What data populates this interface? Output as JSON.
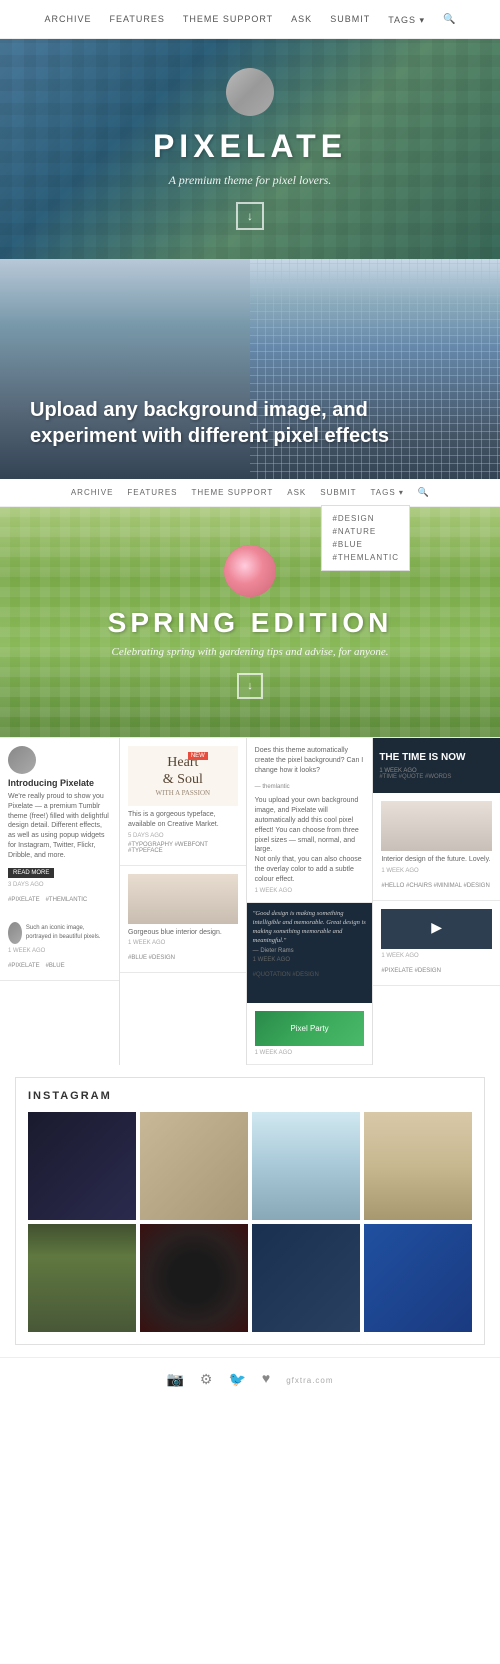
{
  "nav": {
    "items": [
      {
        "label": "ARCHIVE",
        "id": "archive"
      },
      {
        "label": "FEATURES",
        "id": "features"
      },
      {
        "label": "THEME SUPPORT",
        "id": "theme-support"
      },
      {
        "label": "ASK",
        "id": "ask"
      },
      {
        "label": "SUBMIT",
        "id": "submit"
      },
      {
        "label": "TAGS ▾",
        "id": "tags"
      },
      {
        "label": "🔍",
        "id": "search"
      }
    ],
    "tags_dropdown": [
      "#DESIGN",
      "#NATURE",
      "#BLUE",
      "#THEMLANTIC"
    ]
  },
  "hero": {
    "title": "PIXELATE",
    "subtitle": "A premium theme for pixel lovers.",
    "down_arrow": "↓"
  },
  "mountain": {
    "heading": "Upload any background image, and experiment with different pixel effects"
  },
  "spring": {
    "title": "SPRING EDITION",
    "subtitle": "Celebrating spring with gardening tips and advise, for anyone.",
    "down_arrow": "↓",
    "tags_menu": [
      "#DESIGN",
      "#NATURE",
      "#BLUE",
      "#THEMLANTIC"
    ]
  },
  "blog": {
    "col1": {
      "title": "Introducing Pixelate",
      "body": "We're really proud to show you Pixelate — a premium Tumblr theme (free!) filled with delightful design detail. Different effects, as well as using popup widgets for Instagram, Twitter, Flickr, Dribble, and more.",
      "read_more": "READ MORE",
      "meta1": "3 DAYS AGO",
      "tag1": "#PIXELATE",
      "tag2": "#THEMLANTIC"
    },
    "col2": {
      "card1_badge": "NEW",
      "card1_label": "Heart & Soul",
      "card1_sublabel": "WITH A PASSION",
      "card1_desc": "This is a gorgeous typeface, available on Creative Market.",
      "card1_meta": "5 DAYS AGO",
      "card1_tags": "#TYPOGRAPHY #WEBFONT #TYPEFACE",
      "card2_desc": "Gorgeous blue interior design.",
      "card2_meta": "1 WEEK AGO",
      "card2_tags": "#BLUE #DESIGN"
    },
    "col3": {
      "card1_desc": "Does this theme automatically create the pixel background? Can I change how it looks?",
      "card1_attribution": "— themlantic",
      "card1_body": "You upload your own background image, and Pixelate will automatically add this cool pixel effect! You can choose from three pixel sizes — small, normal, and large.",
      "card1_body2": "Not only that, you can also choose the overlay color to add a subtle colour effect.",
      "card1_meta": "1 WEEK AGO",
      "card2_text": "\"Good design is making something intelligible and memorable. Great design is making something memorable and meaningful.\"",
      "card2_author": "— Dieter Rams",
      "card2_meta": "1 WEEK AGO",
      "card2_tags": "#QUOTATION #DESIGN",
      "card3_title": "Pixel Party",
      "card3_meta": "1 WEEK AGO"
    },
    "col4": {
      "card1_title": "THE TIME IS NOW",
      "card1_meta": "1 WEEK AGO",
      "card1_tags": "#TIME #QUOTE #WORDS",
      "card2_desc": "Interior design of the future. Lovely.",
      "card2_meta": "1 WEEK AGO",
      "card2_tags": "#HELLO #CHAIRS #MINIMAL #DESIGN",
      "card3_meta": "1 WEEK AGO",
      "card3_tags": "#PIXELATE #DESIGN"
    }
  },
  "instagram": {
    "title": "INSTAGRAM",
    "photos": [
      {
        "color": "dark",
        "label": "photo1"
      },
      {
        "color": "camera",
        "label": "photo2"
      },
      {
        "color": "snow",
        "label": "photo3"
      },
      {
        "color": "desert",
        "label": "photo4"
      },
      {
        "color": "forest",
        "label": "photo5"
      },
      {
        "color": "vinyl",
        "label": "photo6"
      },
      {
        "color": "circles",
        "label": "photo7"
      },
      {
        "color": "blue",
        "label": "photo8"
      }
    ]
  },
  "footer": {
    "icons": [
      "📷",
      "⚙",
      "🐦",
      "♥"
    ],
    "brand": "gfxtra.com"
  }
}
